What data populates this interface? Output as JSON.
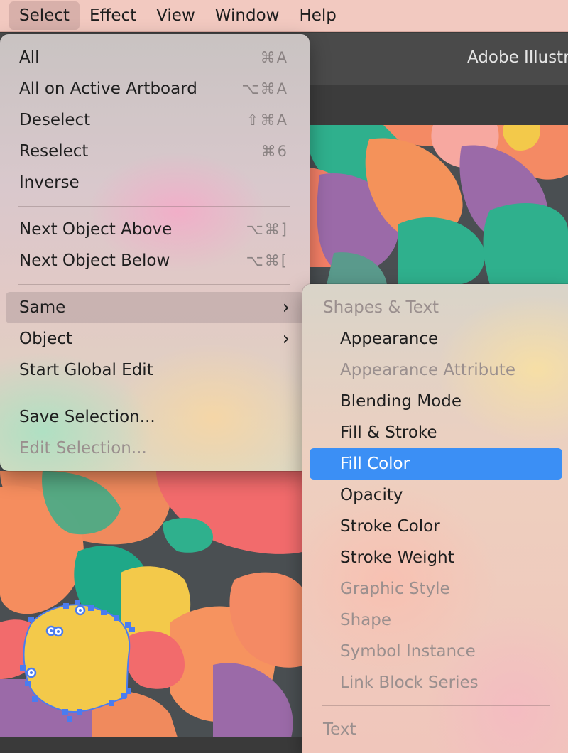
{
  "menubar": {
    "items": [
      "Select",
      "Effect",
      "View",
      "Window",
      "Help"
    ],
    "active": "Select"
  },
  "app": {
    "title": "Adobe Illustr"
  },
  "select_menu": {
    "items": [
      {
        "label": "All",
        "shortcut": "⌘A"
      },
      {
        "label": "All on Active Artboard",
        "shortcut": "⌥⌘A"
      },
      {
        "label": "Deselect",
        "shortcut": "⇧⌘A"
      },
      {
        "label": "Reselect",
        "shortcut": "⌘6"
      },
      {
        "label": "Inverse",
        "shortcut": ""
      },
      {
        "label": "Next Object Above",
        "shortcut": "⌥⌘]"
      },
      {
        "label": "Next Object Below",
        "shortcut": "⌥⌘["
      },
      {
        "label": "Same",
        "submenu": true,
        "highlighted": true
      },
      {
        "label": "Object",
        "submenu": true
      },
      {
        "label": "Start Global Edit",
        "shortcut": ""
      },
      {
        "label": "Save Selection...",
        "shortcut": ""
      },
      {
        "label": "Edit Selection...",
        "disabled": true
      }
    ]
  },
  "same_submenu": {
    "header_shapes": "Shapes & Text",
    "items": [
      {
        "label": "Appearance",
        "enabled": true
      },
      {
        "label": "Appearance Attribute",
        "enabled": false
      },
      {
        "label": "Blending Mode",
        "enabled": true
      },
      {
        "label": "Fill & Stroke",
        "enabled": true
      },
      {
        "label": "Fill Color",
        "enabled": true,
        "selected": true
      },
      {
        "label": "Opacity",
        "enabled": true
      },
      {
        "label": "Stroke Color",
        "enabled": true
      },
      {
        "label": "Stroke Weight",
        "enabled": true
      },
      {
        "label": "Graphic Style",
        "enabled": false
      },
      {
        "label": "Shape",
        "enabled": false
      },
      {
        "label": "Symbol Instance",
        "enabled": false
      },
      {
        "label": "Link Block Series",
        "enabled": false
      }
    ],
    "header_text": "Text"
  },
  "colors": {
    "selection_blue": "#3b8ff5",
    "anchor_blue": "#4a7cf0",
    "selected_shape_yellow": "#f3c94a"
  }
}
